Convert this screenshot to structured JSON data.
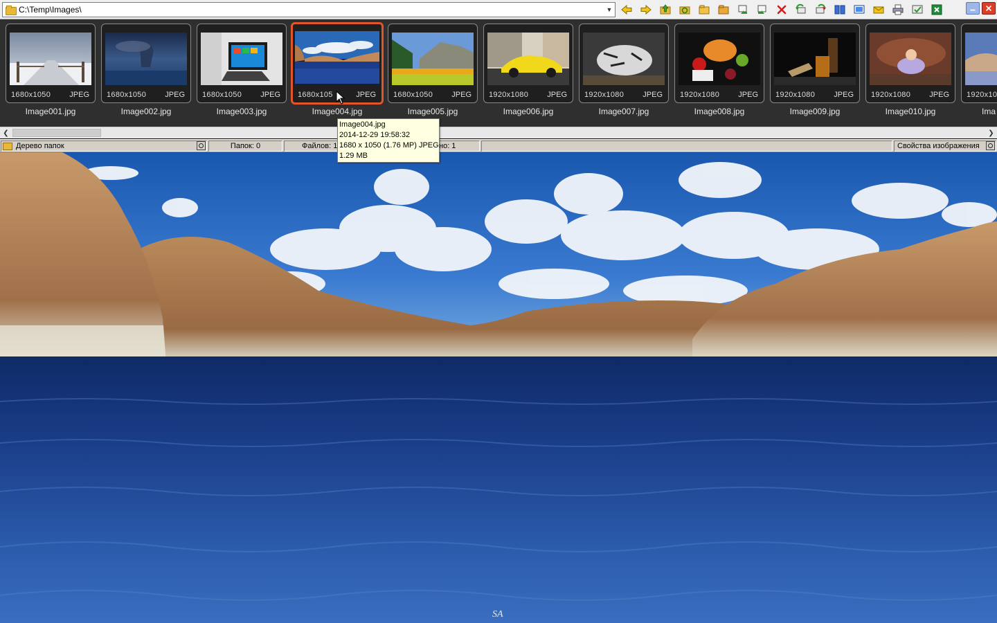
{
  "path_bar": {
    "path": "C:\\Temp\\Images\\"
  },
  "toolbar": {
    "icons": [
      "arrow-left-icon",
      "arrow-right-icon",
      "folder-up-icon",
      "refresh-icon",
      "folder-open-icon",
      "new-folder-icon",
      "copy-to-icon",
      "move-to-icon",
      "delete-icon",
      "rotate-left-icon",
      "rotate-right-icon",
      "compare-icon",
      "slideshow-icon",
      "email-icon",
      "print-icon",
      "wallpaper-icon",
      "export-excel-icon"
    ]
  },
  "window_controls": {
    "icons": [
      "minimize-icon",
      "close-icon"
    ]
  },
  "thumbnails": [
    {
      "name": "Image001.jpg",
      "dims": "1680x1050",
      "format": "JPEG"
    },
    {
      "name": "Image002.jpg",
      "dims": "1680x1050",
      "format": "JPEG"
    },
    {
      "name": "Image003.jpg",
      "dims": "1680x1050",
      "format": "JPEG"
    },
    {
      "name": "Image004.jpg",
      "dims": "1680x105",
      "format": "JPEG",
      "selected": true
    },
    {
      "name": "Image005.jpg",
      "dims": "1680x1050",
      "format": "JPEG"
    },
    {
      "name": "Image006.jpg",
      "dims": "1920x1080",
      "format": "JPEG"
    },
    {
      "name": "Image007.jpg",
      "dims": "1920x1080",
      "format": "JPEG"
    },
    {
      "name": "Image008.jpg",
      "dims": "1920x1080",
      "format": "JPEG"
    },
    {
      "name": "Image009.jpg",
      "dims": "1920x1080",
      "format": "JPEG"
    },
    {
      "name": "Image010.jpg",
      "dims": "1920x1080",
      "format": "JPEG"
    },
    {
      "name": "Ima",
      "dims": "1920x10",
      "format": ""
    }
  ],
  "statusbar": {
    "folder_tree": "Дерево папок",
    "folders": "Папок: 0",
    "files": "Файлов: 1",
    "selected": "но: 1",
    "properties": "Свойства изображения"
  },
  "tooltip": {
    "line1": "Image004.jpg",
    "line2": "2014-12-29 19:58:32",
    "line3": "1680 x 1050 (1.76 MP)  JPEG",
    "line4": "1.29 MB"
  },
  "viewer": {
    "watermark": "SA"
  },
  "colors": {
    "selection": "#e0552a",
    "strip_bg": "#2f2f2f",
    "tooltip_bg": "#ffffe1"
  }
}
